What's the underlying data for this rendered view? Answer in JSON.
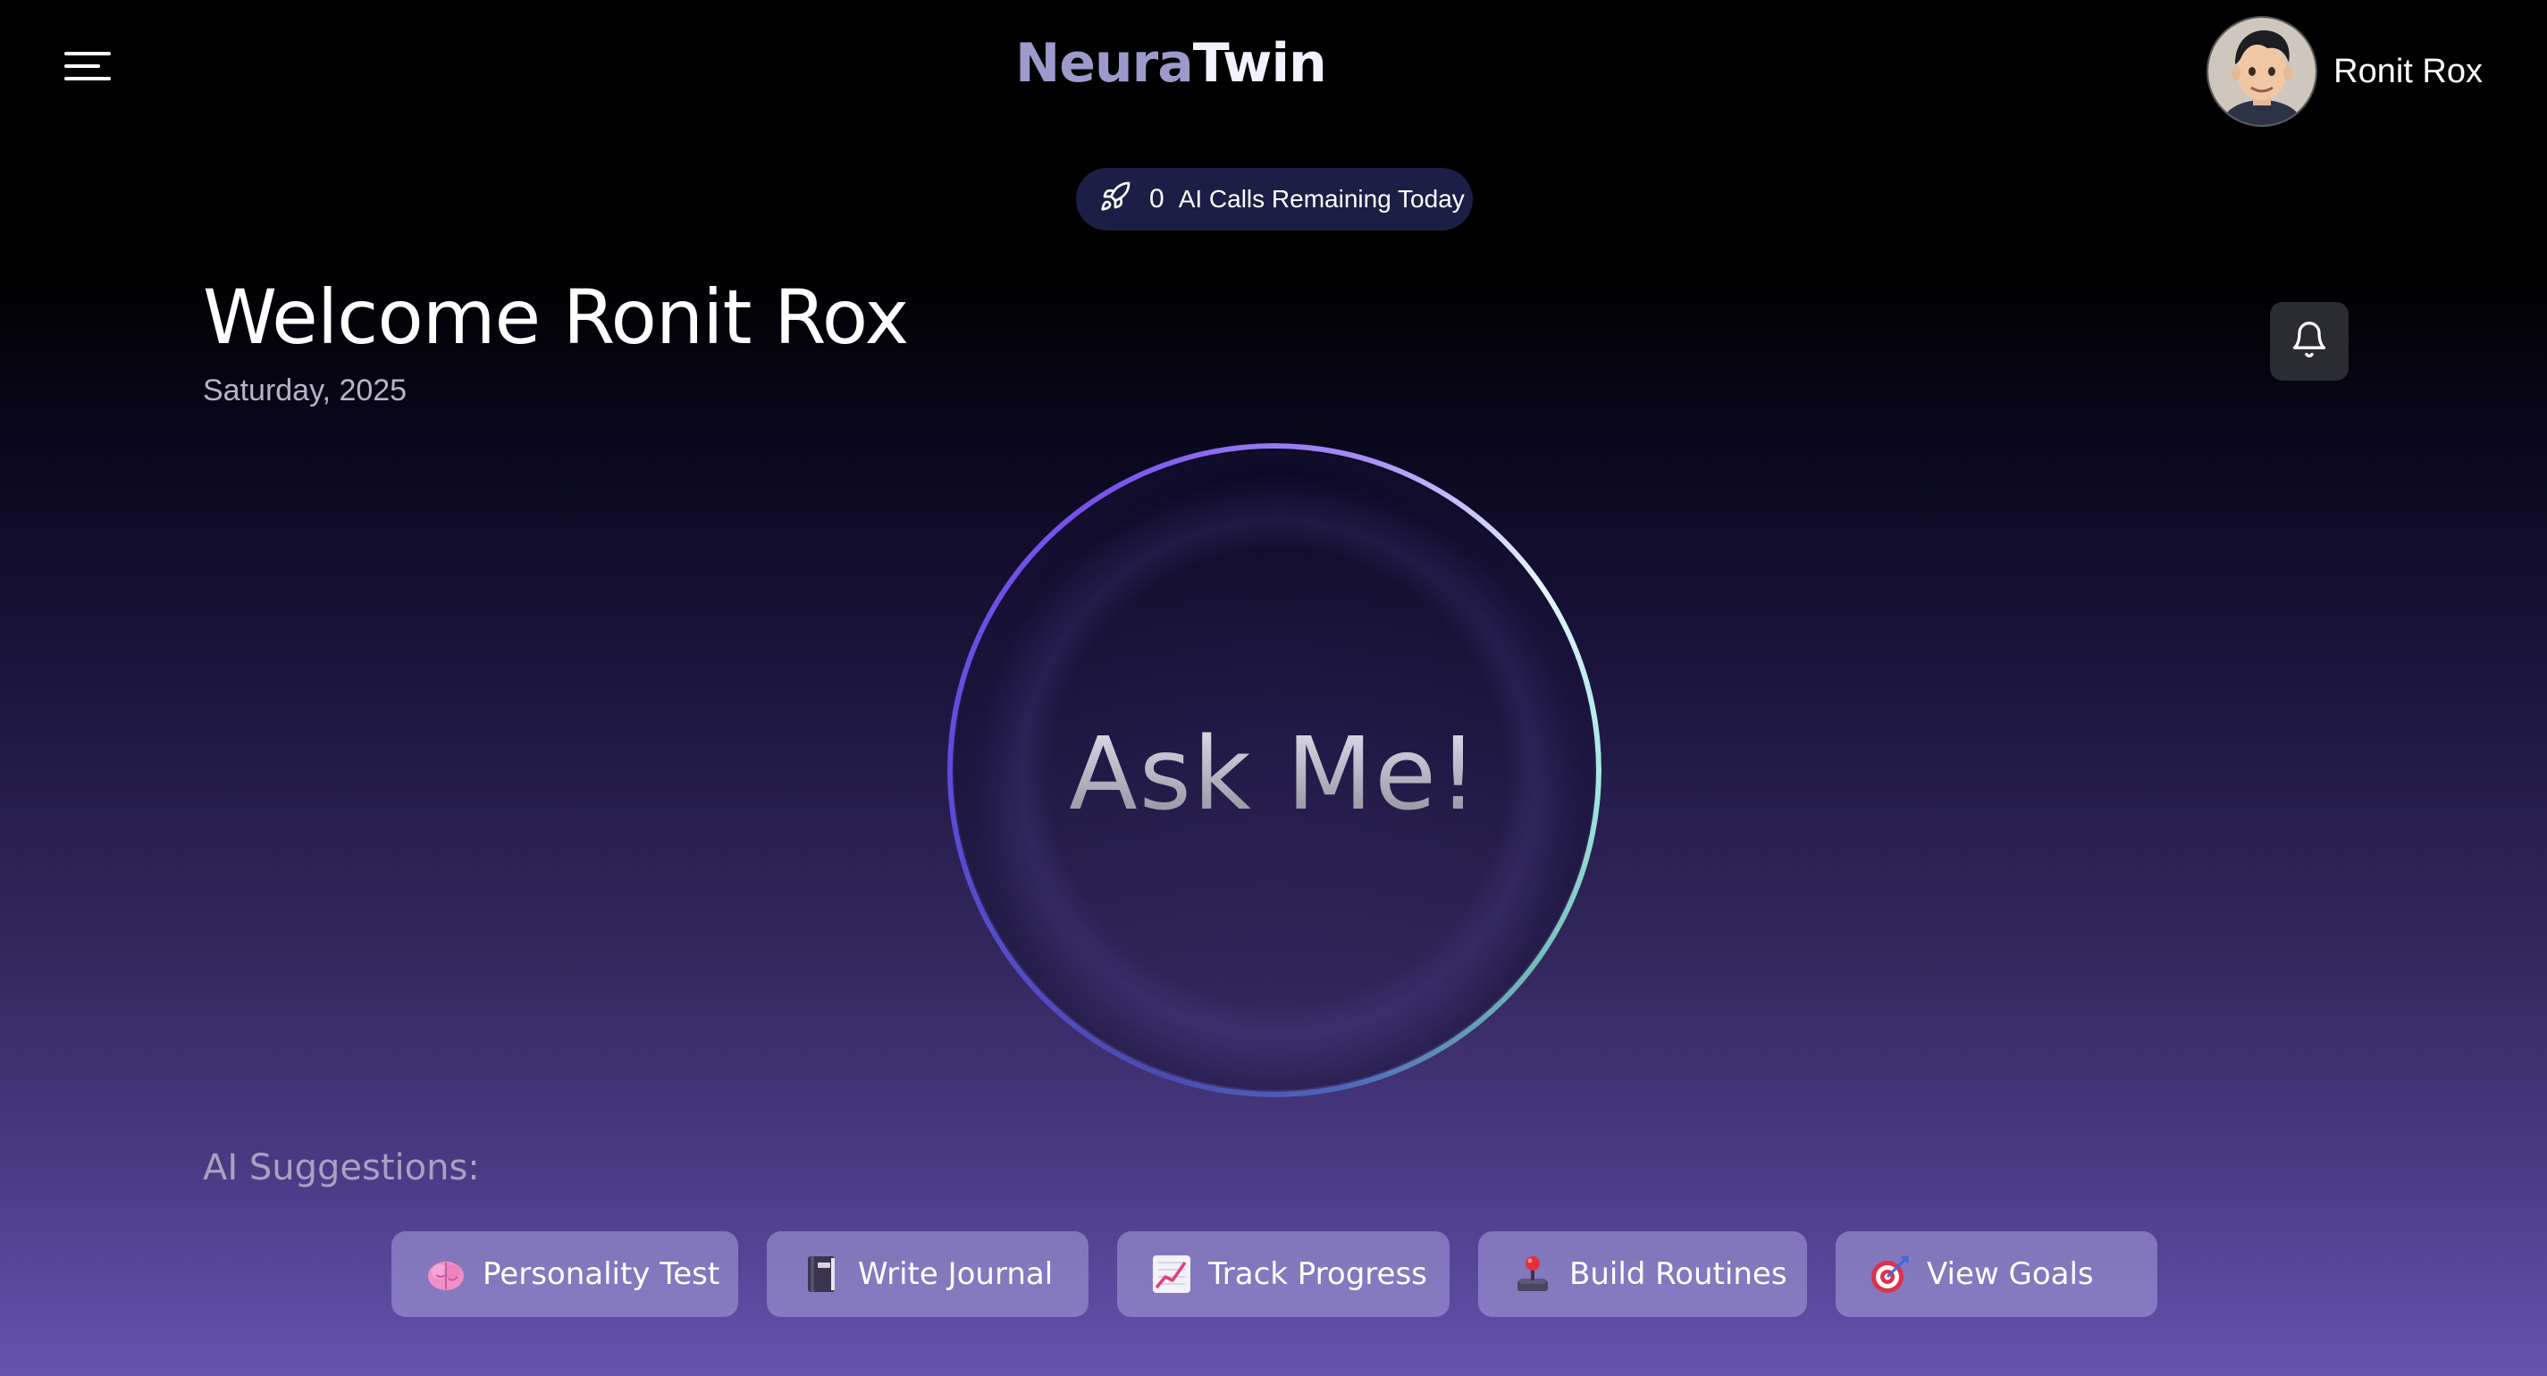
{
  "header": {
    "logo_part1": "Neura",
    "logo_part2": "Twin",
    "user_name": "Ronit Rox",
    "menu_icon": "hamburger-menu-icon",
    "avatar_icon": "user-avatar"
  },
  "ai_calls": {
    "count": "0",
    "label": "AI Calls Remaining Today",
    "icon": "rocket-icon"
  },
  "welcome": {
    "title": "Welcome Ronit Rox",
    "date": "Saturday, 2025",
    "bell_icon": "bell-icon"
  },
  "orb": {
    "text": "Ask Me!"
  },
  "suggestions": {
    "title": "AI Suggestions:",
    "items": [
      {
        "label": "Personality Test",
        "icon": "brain-icon"
      },
      {
        "label": "Write Journal",
        "icon": "notebook-icon"
      },
      {
        "label": "Track Progress",
        "icon": "chart-increasing-icon"
      },
      {
        "label": "Build Routines",
        "icon": "joystick-icon"
      },
      {
        "label": "View Goals",
        "icon": "target-icon"
      }
    ]
  },
  "colors": {
    "accent_purple": "#7b52ee",
    "pill_bg": "#1b1f45",
    "chip_bg": "#a9a0dc"
  }
}
